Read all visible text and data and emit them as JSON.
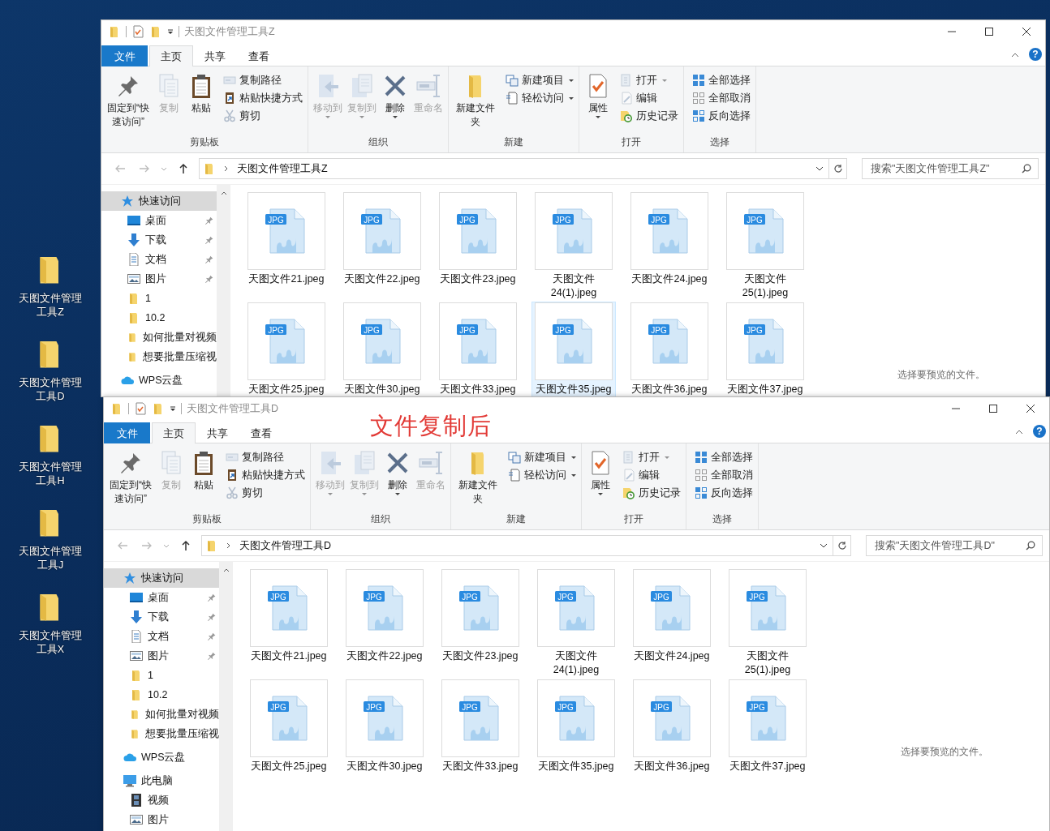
{
  "desktop_icons": [
    {
      "label": "天图文件管理工具Z"
    },
    {
      "label": "天图文件管理工具D"
    },
    {
      "label": "天图文件管理工具H"
    },
    {
      "label": "天图文件管理工具J"
    },
    {
      "label": "天图文件管理工具X"
    }
  ],
  "windows": [
    {
      "title": "天图文件管理工具Z",
      "tabs": [
        {
          "label": "文件",
          "kind": "file",
          "selected": false
        },
        {
          "label": "主页",
          "kind": "tab",
          "selected": true
        },
        {
          "label": "共享",
          "kind": "tab",
          "selected": false
        },
        {
          "label": "查看",
          "kind": "tab",
          "selected": false
        }
      ],
      "help": "?",
      "ribbon": {
        "groups": [
          {
            "label": "剪贴板",
            "buttons": [
              {
                "label": "固定到“快速访问”",
                "kind": "large",
                "disabled": false,
                "dropdown": false
              },
              {
                "label": "复制",
                "kind": "large",
                "disabled": true,
                "dropdown": false
              },
              {
                "label": "粘贴",
                "kind": "large",
                "disabled": false,
                "dropdown": false
              },
              {
                "label": "复制路径",
                "kind": "small",
                "disabled": true,
                "dropdown": false
              },
              {
                "label": "粘贴快捷方式",
                "kind": "small",
                "disabled": false,
                "dropdown": false
              },
              {
                "label": "剪切",
                "kind": "small",
                "disabled": true,
                "dropdown": false
              }
            ]
          },
          {
            "label": "组织",
            "buttons": [
              {
                "label": "移动到",
                "kind": "large",
                "disabled": true,
                "dropdown": true
              },
              {
                "label": "复制到",
                "kind": "large",
                "disabled": true,
                "dropdown": true
              },
              {
                "label": "删除",
                "kind": "large",
                "disabled": false,
                "dropdown": true
              },
              {
                "label": "重命名",
                "kind": "large",
                "disabled": true,
                "dropdown": false
              }
            ]
          },
          {
            "label": "新建",
            "buttons": [
              {
                "label": "新建文件夹",
                "kind": "large",
                "disabled": false,
                "dropdown": false
              },
              {
                "label": "新建项目",
                "kind": "small",
                "disabled": false,
                "dropdown": true
              },
              {
                "label": "轻松访问",
                "kind": "small",
                "disabled": false,
                "dropdown": true
              }
            ]
          },
          {
            "label": "打开",
            "buttons": [
              {
                "label": "属性",
                "kind": "large",
                "disabled": false,
                "dropdown": true
              },
              {
                "label": "打开",
                "kind": "small",
                "disabled": true,
                "dropdown": true
              },
              {
                "label": "编辑",
                "kind": "small",
                "disabled": true,
                "dropdown": false
              },
              {
                "label": "历史记录",
                "kind": "small",
                "disabled": false,
                "dropdown": false
              }
            ]
          },
          {
            "label": "选择",
            "buttons": [
              {
                "label": "全部选择",
                "kind": "small",
                "disabled": false,
                "dropdown": false
              },
              {
                "label": "全部取消",
                "kind": "small",
                "disabled": false,
                "dropdown": false
              },
              {
                "label": "反向选择",
                "kind": "small",
                "disabled": false,
                "dropdown": false
              }
            ]
          }
        ]
      },
      "address": {
        "path": "天图文件管理工具Z"
      },
      "search": {
        "placeholder": "搜索\"天图文件管理工具Z\""
      },
      "nav": [
        {
          "label": "快速访问",
          "kind": "star",
          "selected": true,
          "children": [
            {
              "label": "桌面",
              "kind": "desktop",
              "selected": false,
              "pinned": true
            },
            {
              "label": "下载",
              "kind": "download",
              "selected": false,
              "pinned": true
            },
            {
              "label": "文档",
              "kind": "document",
              "selected": false,
              "pinned": true
            },
            {
              "label": "图片",
              "kind": "pictures",
              "selected": false,
              "pinned": true
            },
            {
              "label": "1",
              "kind": "folder",
              "selected": false,
              "pinned": false
            },
            {
              "label": "10.2",
              "kind": "folder",
              "selected": false,
              "pinned": false
            },
            {
              "label": "如何批量对视频",
              "kind": "folder",
              "selected": false,
              "pinned": false
            },
            {
              "label": "想要批量压缩视",
              "kind": "folder",
              "selected": false,
              "pinned": false
            }
          ]
        },
        {
          "label": "WPS云盘",
          "kind": "cloud",
          "selected": false
        }
      ],
      "files": [
        {
          "name": "天图文件21.jpeg",
          "type_label": "JPG",
          "selected": false
        },
        {
          "name": "天图文件22.jpeg",
          "type_label": "JPG",
          "selected": false
        },
        {
          "name": "天图文件23.jpeg",
          "type_label": "JPG",
          "selected": false
        },
        {
          "name": "天图文件24(1).jpeg",
          "type_label": "JPG",
          "selected": false
        },
        {
          "name": "天图文件24.jpeg",
          "type_label": "JPG",
          "selected": false
        },
        {
          "name": "天图文件25(1).jpeg",
          "type_label": "JPG",
          "selected": false
        },
        {
          "name": "天图文件25.jpeg",
          "type_label": "JPG",
          "selected": false
        },
        {
          "name": "天图文件30.jpeg",
          "type_label": "JPG",
          "selected": false
        },
        {
          "name": "天图文件33.jpeg",
          "type_label": "JPG",
          "selected": false
        },
        {
          "name": "天图文件35.jpeg",
          "type_label": "JPG",
          "selected": true
        },
        {
          "name": "天图文件36.jpeg",
          "type_label": "JPG",
          "selected": false
        },
        {
          "name": "天图文件37.jpeg",
          "type_label": "JPG",
          "selected": false
        }
      ],
      "preview_text": "选择要预览的文件。"
    },
    {
      "title": "天图文件管理工具D",
      "annotation": "文件复制后",
      "tabs": [
        {
          "label": "文件",
          "kind": "file",
          "selected": false
        },
        {
          "label": "主页",
          "kind": "tab",
          "selected": true
        },
        {
          "label": "共享",
          "kind": "tab",
          "selected": false
        },
        {
          "label": "查看",
          "kind": "tab",
          "selected": false
        }
      ],
      "help": "?",
      "ribbon": {
        "groups": [
          {
            "label": "剪贴板",
            "buttons": [
              {
                "label": "固定到“快速访问”",
                "kind": "large",
                "disabled": false,
                "dropdown": false
              },
              {
                "label": "复制",
                "kind": "large",
                "disabled": true,
                "dropdown": false
              },
              {
                "label": "粘贴",
                "kind": "large",
                "disabled": false,
                "dropdown": false
              },
              {
                "label": "复制路径",
                "kind": "small",
                "disabled": true,
                "dropdown": false
              },
              {
                "label": "粘贴快捷方式",
                "kind": "small",
                "disabled": false,
                "dropdown": false
              },
              {
                "label": "剪切",
                "kind": "small",
                "disabled": true,
                "dropdown": false
              }
            ]
          },
          {
            "label": "组织",
            "buttons": [
              {
                "label": "移动到",
                "kind": "large",
                "disabled": true,
                "dropdown": true
              },
              {
                "label": "复制到",
                "kind": "large",
                "disabled": true,
                "dropdown": true
              },
              {
                "label": "删除",
                "kind": "large",
                "disabled": false,
                "dropdown": true
              },
              {
                "label": "重命名",
                "kind": "large",
                "disabled": true,
                "dropdown": false
              }
            ]
          },
          {
            "label": "新建",
            "buttons": [
              {
                "label": "新建文件夹",
                "kind": "large",
                "disabled": false,
                "dropdown": false
              },
              {
                "label": "新建项目",
                "kind": "small",
                "disabled": false,
                "dropdown": true
              },
              {
                "label": "轻松访问",
                "kind": "small",
                "disabled": false,
                "dropdown": true
              }
            ]
          },
          {
            "label": "打开",
            "buttons": [
              {
                "label": "属性",
                "kind": "large",
                "disabled": false,
                "dropdown": true
              },
              {
                "label": "打开",
                "kind": "small",
                "disabled": true,
                "dropdown": true
              },
              {
                "label": "编辑",
                "kind": "small",
                "disabled": true,
                "dropdown": false
              },
              {
                "label": "历史记录",
                "kind": "small",
                "disabled": false,
                "dropdown": false
              }
            ]
          },
          {
            "label": "选择",
            "buttons": [
              {
                "label": "全部选择",
                "kind": "small",
                "disabled": false,
                "dropdown": false
              },
              {
                "label": "全部取消",
                "kind": "small",
                "disabled": false,
                "dropdown": false
              },
              {
                "label": "反向选择",
                "kind": "small",
                "disabled": false,
                "dropdown": false
              }
            ]
          }
        ]
      },
      "address": {
        "path": "天图文件管理工具D"
      },
      "search": {
        "placeholder": "搜索\"天图文件管理工具D\""
      },
      "nav": [
        {
          "label": "快速访问",
          "kind": "star",
          "selected": true,
          "children": [
            {
              "label": "桌面",
              "kind": "desktop",
              "selected": false,
              "pinned": true
            },
            {
              "label": "下载",
              "kind": "download",
              "selected": false,
              "pinned": true
            },
            {
              "label": "文档",
              "kind": "document",
              "selected": false,
              "pinned": true
            },
            {
              "label": "图片",
              "kind": "pictures",
              "selected": false,
              "pinned": true
            },
            {
              "label": "1",
              "kind": "folder",
              "selected": false,
              "pinned": false
            },
            {
              "label": "10.2",
              "kind": "folder",
              "selected": false,
              "pinned": false
            },
            {
              "label": "如何批量对视频",
              "kind": "folder",
              "selected": false,
              "pinned": false
            },
            {
              "label": "想要批量压缩视",
              "kind": "folder",
              "selected": false,
              "pinned": false
            }
          ]
        },
        {
          "label": "WPS云盘",
          "kind": "cloud",
          "selected": false
        },
        {
          "label": "此电脑",
          "kind": "pc",
          "selected": false,
          "children": [
            {
              "label": "视频",
              "kind": "video",
              "selected": false
            },
            {
              "label": "图片",
              "kind": "pictures",
              "selected": false
            }
          ]
        }
      ],
      "files": [
        {
          "name": "天图文件21.jpeg",
          "type_label": "JPG",
          "selected": false
        },
        {
          "name": "天图文件22.jpeg",
          "type_label": "JPG",
          "selected": false
        },
        {
          "name": "天图文件23.jpeg",
          "type_label": "JPG",
          "selected": false
        },
        {
          "name": "天图文件24(1).jpeg",
          "type_label": "JPG",
          "selected": false
        },
        {
          "name": "天图文件24.jpeg",
          "type_label": "JPG",
          "selected": false
        },
        {
          "name": "天图文件25(1).jpeg",
          "type_label": "JPG",
          "selected": false
        },
        {
          "name": "天图文件25.jpeg",
          "type_label": "JPG",
          "selected": false
        },
        {
          "name": "天图文件30.jpeg",
          "type_label": "JPG",
          "selected": false
        },
        {
          "name": "天图文件33.jpeg",
          "type_label": "JPG",
          "selected": false
        },
        {
          "name": "天图文件35.jpeg",
          "type_label": "JPG",
          "selected": false
        },
        {
          "name": "天图文件36.jpeg",
          "type_label": "JPG",
          "selected": false
        },
        {
          "name": "天图文件37.jpeg",
          "type_label": "JPG",
          "selected": false
        }
      ],
      "preview_text": "选择要预览的文件。"
    }
  ]
}
